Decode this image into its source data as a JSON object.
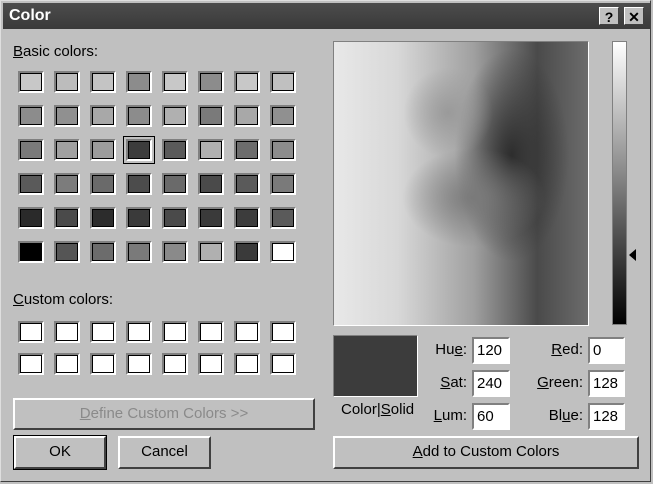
{
  "window": {
    "title": "Color",
    "help_glyph": "?",
    "close_glyph": "✕"
  },
  "basic_colors": {
    "label_accel": "B",
    "label_rest": "asic colors:",
    "rows": [
      [
        "#c8c8c8",
        "#bcbcbc",
        "#c4c4c4",
        "#8c8c8c",
        "#c8c8c8",
        "#8c8c8c",
        "#c8c8c8",
        "#c0c0c0"
      ],
      [
        "#8c8c8c",
        "#909090",
        "#a8a8a8",
        "#8c8c8c",
        "#b0b0b0",
        "#7a7a7a",
        "#a8a8a8",
        "#909090"
      ],
      [
        "#7a7a7a",
        "#a0a0a0",
        "#9c9c9c",
        "#3c3c3c",
        "#5a5a5a",
        "#b0b0b0",
        "#6c6c6c",
        "#8c8c8c"
      ],
      [
        "#5a5a5a",
        "#7c7c7c",
        "#6a6a6a",
        "#4c4c4c",
        "#6a6a6a",
        "#4a4a4a",
        "#5a5a5a",
        "#7a7a7a"
      ],
      [
        "#2a2a2a",
        "#4a4a4a",
        "#2c2c2c",
        "#3a3a3a",
        "#4a4a4a",
        "#3a3a3a",
        "#3c3c3c",
        "#5a5a5a"
      ],
      [
        "#000000",
        "#555555",
        "#6c6c6c",
        "#7a7a7a",
        "#8a8a8a",
        "#b0b0b0",
        "#3a3a3a",
        "#ffffff"
      ]
    ],
    "selected": "row 3, col 4"
  },
  "custom_colors": {
    "label_accel": "C",
    "label_rest": "ustom colors:",
    "swatch_color": "#ffffff"
  },
  "buttons": {
    "define_custom_accel": "D",
    "define_custom_rest": "efine Custom Colors >>",
    "ok": "OK",
    "cancel": "Cancel",
    "add_custom_accel": "A",
    "add_custom_rest": "dd to Custom Colors"
  },
  "preview": {
    "label_a": "Color|",
    "label_accel": "S",
    "label_b": "olid",
    "color": "#3c3c3c"
  },
  "fields": {
    "hue": {
      "label_pre": "Hu",
      "label_accel": "e",
      "label_post": ":",
      "value": "120"
    },
    "sat": {
      "label_pre": "",
      "label_accel": "S",
      "label_post": "at:",
      "value": "240"
    },
    "lum": {
      "label_pre": "",
      "label_accel": "L",
      "label_post": "um:",
      "value": "60"
    },
    "red": {
      "label_pre": "",
      "label_accel": "R",
      "label_post": "ed:",
      "value": "0"
    },
    "green": {
      "label_pre": "",
      "label_accel": "G",
      "label_post": "reen:",
      "value": "128"
    },
    "blue": {
      "label_pre": "Bl",
      "label_accel": "u",
      "label_post": "e:",
      "value": "128"
    }
  }
}
